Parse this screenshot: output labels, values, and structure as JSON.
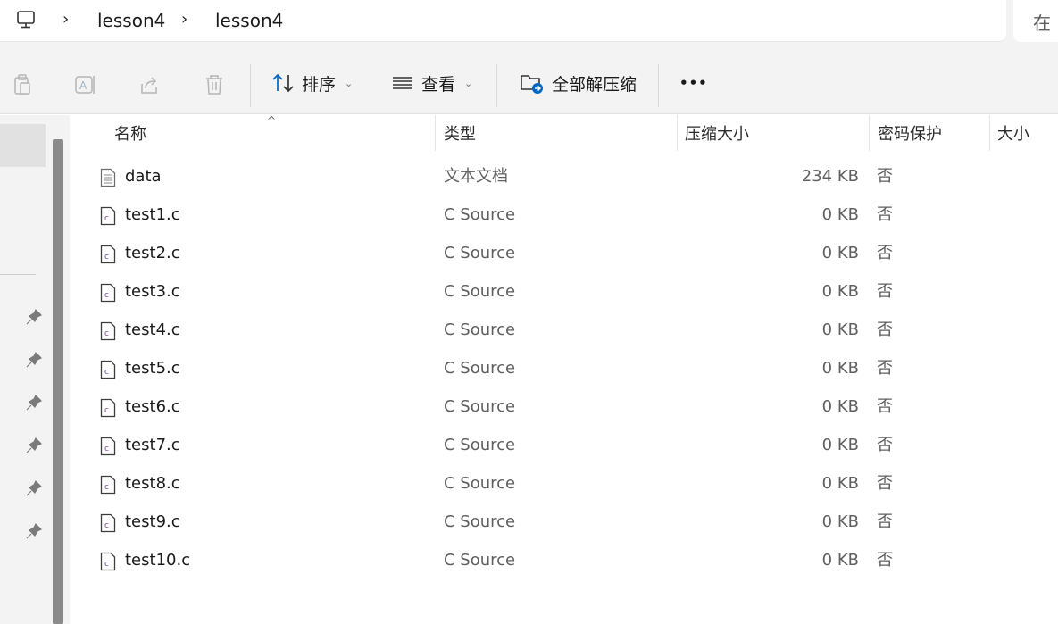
{
  "breadcrumb": {
    "items": [
      "lesson4",
      "lesson4"
    ]
  },
  "search": {
    "label": "在"
  },
  "toolbar": {
    "sort_label": "排序",
    "view_label": "查看",
    "extract_all_label": "全部解压缩",
    "more_label": "•••"
  },
  "columns": {
    "name": "名称",
    "type": "类型",
    "compressed_size": "压缩大小",
    "password": "密码保护",
    "size": "大小"
  },
  "files": [
    {
      "name": "data",
      "type": "文本文档",
      "compressed_size": "234 KB",
      "password": "否",
      "icon": "text-file-icon"
    },
    {
      "name": "test1.c",
      "type": "C Source",
      "compressed_size": "0 KB",
      "password": "否",
      "icon": "c-file-icon"
    },
    {
      "name": "test2.c",
      "type": "C Source",
      "compressed_size": "0 KB",
      "password": "否",
      "icon": "c-file-icon"
    },
    {
      "name": "test3.c",
      "type": "C Source",
      "compressed_size": "0 KB",
      "password": "否",
      "icon": "c-file-icon"
    },
    {
      "name": "test4.c",
      "type": "C Source",
      "compressed_size": "0 KB",
      "password": "否",
      "icon": "c-file-icon"
    },
    {
      "name": "test5.c",
      "type": "C Source",
      "compressed_size": "0 KB",
      "password": "否",
      "icon": "c-file-icon"
    },
    {
      "name": "test6.c",
      "type": "C Source",
      "compressed_size": "0 KB",
      "password": "否",
      "icon": "c-file-icon"
    },
    {
      "name": "test7.c",
      "type": "C Source",
      "compressed_size": "0 KB",
      "password": "否",
      "icon": "c-file-icon"
    },
    {
      "name": "test8.c",
      "type": "C Source",
      "compressed_size": "0 KB",
      "password": "否",
      "icon": "c-file-icon"
    },
    {
      "name": "test9.c",
      "type": "C Source",
      "compressed_size": "0 KB",
      "password": "否",
      "icon": "c-file-icon"
    },
    {
      "name": "test10.c",
      "type": "C Source",
      "compressed_size": "0 KB",
      "password": "否",
      "icon": "c-file-icon"
    }
  ],
  "colors": {
    "chrome": "#f3f3f3",
    "accent": "#0067c0",
    "c_icon_accent": "#7b3f9e"
  }
}
